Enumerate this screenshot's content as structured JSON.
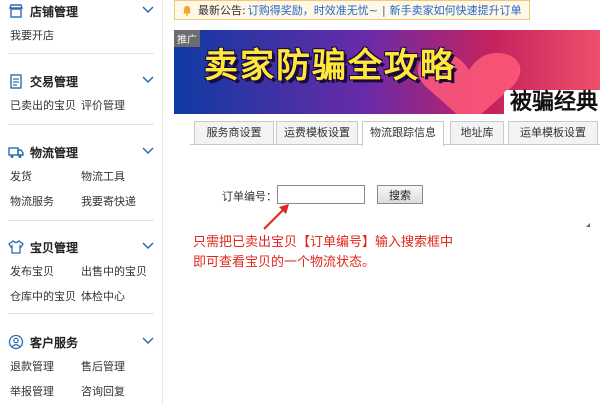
{
  "sidebar": {
    "store": {
      "title": "店铺管理",
      "items": [
        "我要开店"
      ]
    },
    "trade": {
      "title": "交易管理",
      "items": [
        "已卖出的宝贝",
        "评价管理"
      ]
    },
    "logistics": {
      "title": "物流管理",
      "items": [
        "发货",
        "物流工具",
        "物流服务",
        "我要寄快递"
      ]
    },
    "goods": {
      "title": "宝贝管理",
      "items": [
        "发布宝贝",
        "出售中的宝贝",
        "仓库中的宝贝",
        "体检中心"
      ]
    },
    "service": {
      "title": "客户服务",
      "items": [
        "退款管理",
        "售后管理",
        "举报管理",
        "咨询回复"
      ]
    }
  },
  "notice": {
    "label": "最新公告:",
    "link1": "订购得奖励，时效准无忧~",
    "separator": "|",
    "link2": "新手卖家如何快速提升订单"
  },
  "banner": {
    "ad_tag": "推广",
    "headline": "卖家防骗全攻略",
    "sub": "被骗经典"
  },
  "tabs": [
    "服务商设置",
    "运费模板设置",
    "物流跟踪信息",
    "地址库",
    "运单模板设置"
  ],
  "active_tab": "物流跟踪信息",
  "form": {
    "order_label": "订单编号：",
    "order_value": "",
    "search_label": "搜索"
  },
  "annotation": {
    "line1": "只需把已卖出宝贝【订单编号】输入搜索框中",
    "line2": "即可查看宝贝的一个物流状态。"
  },
  "colors": {
    "link": "#2467c5",
    "annotation": "#e0271c",
    "icon": "#2b6cb0"
  }
}
